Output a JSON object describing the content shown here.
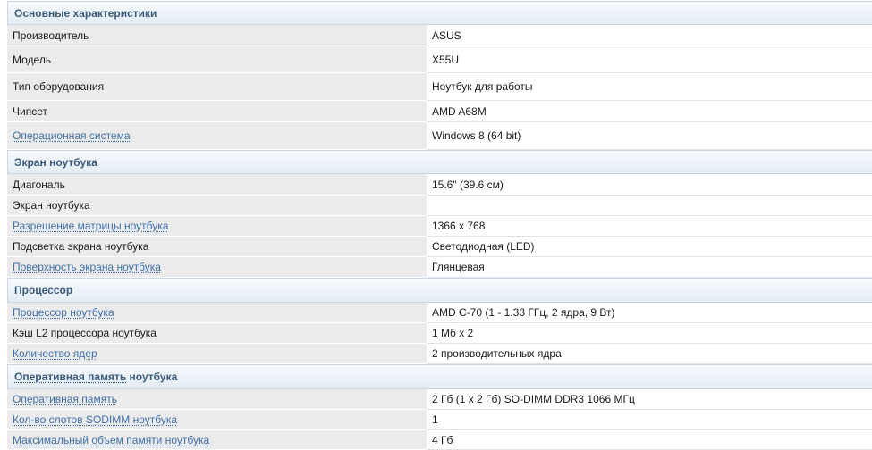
{
  "sections": [
    {
      "title": "Основные характеристики",
      "rows": [
        {
          "label": "Производитель",
          "value": "ASUS"
        },
        {
          "label": "Модель",
          "value": "X55U"
        },
        {
          "label": "Тип оборудования",
          "value": "Ноутбук для работы"
        },
        {
          "label": "Чипсет",
          "value": "AMD A68M"
        },
        {
          "label": "Операционная система",
          "value": "Windows 8 (64 bit)"
        }
      ]
    },
    {
      "title": "Экран ноутбука",
      "rows": [
        {
          "label": "Диагональ",
          "value": "15.6\" (39.6 см)"
        },
        {
          "label": "Экран ноутбука",
          "value": ""
        },
        {
          "label": "Разрешение матрицы ноутбука",
          "value": "1366 x 768"
        },
        {
          "label": "Подсветка экрана ноутбука",
          "value": "Светодиодная (LED)"
        },
        {
          "label": "Поверхность экрана ноутбука",
          "value": "Глянцевая"
        }
      ]
    },
    {
      "title": "Процессор",
      "rows": [
        {
          "label": "Процессор ноутбука",
          "value": "AMD C-70 (1 - 1.33 ГГц, 2 ядра, 9 Вт)"
        },
        {
          "label": "Кэш L2 процессора ноутбука",
          "value": "1 Мб x 2"
        },
        {
          "label": "Количество ядер",
          "value": "2 производительных ядра"
        }
      ]
    },
    {
      "title_link": "Оперативная память",
      "title_rest": " ноутбука",
      "rows": [
        {
          "label": "Оперативная память",
          "value": "2 Гб (1 x 2 Гб) SO-DIMM DDR3 1066 МГц"
        },
        {
          "label": "Кол-во слотов SODIMM ноутбука",
          "value": "1"
        },
        {
          "label": "Максимальный объем памяти ноутбука",
          "value": "4 Гб"
        }
      ]
    }
  ],
  "colors": {
    "link": "#3d6fa8",
    "section_title": "#3a5a7c",
    "label_bg": "#ebebeb",
    "header_bg": "#e4ecf5"
  }
}
